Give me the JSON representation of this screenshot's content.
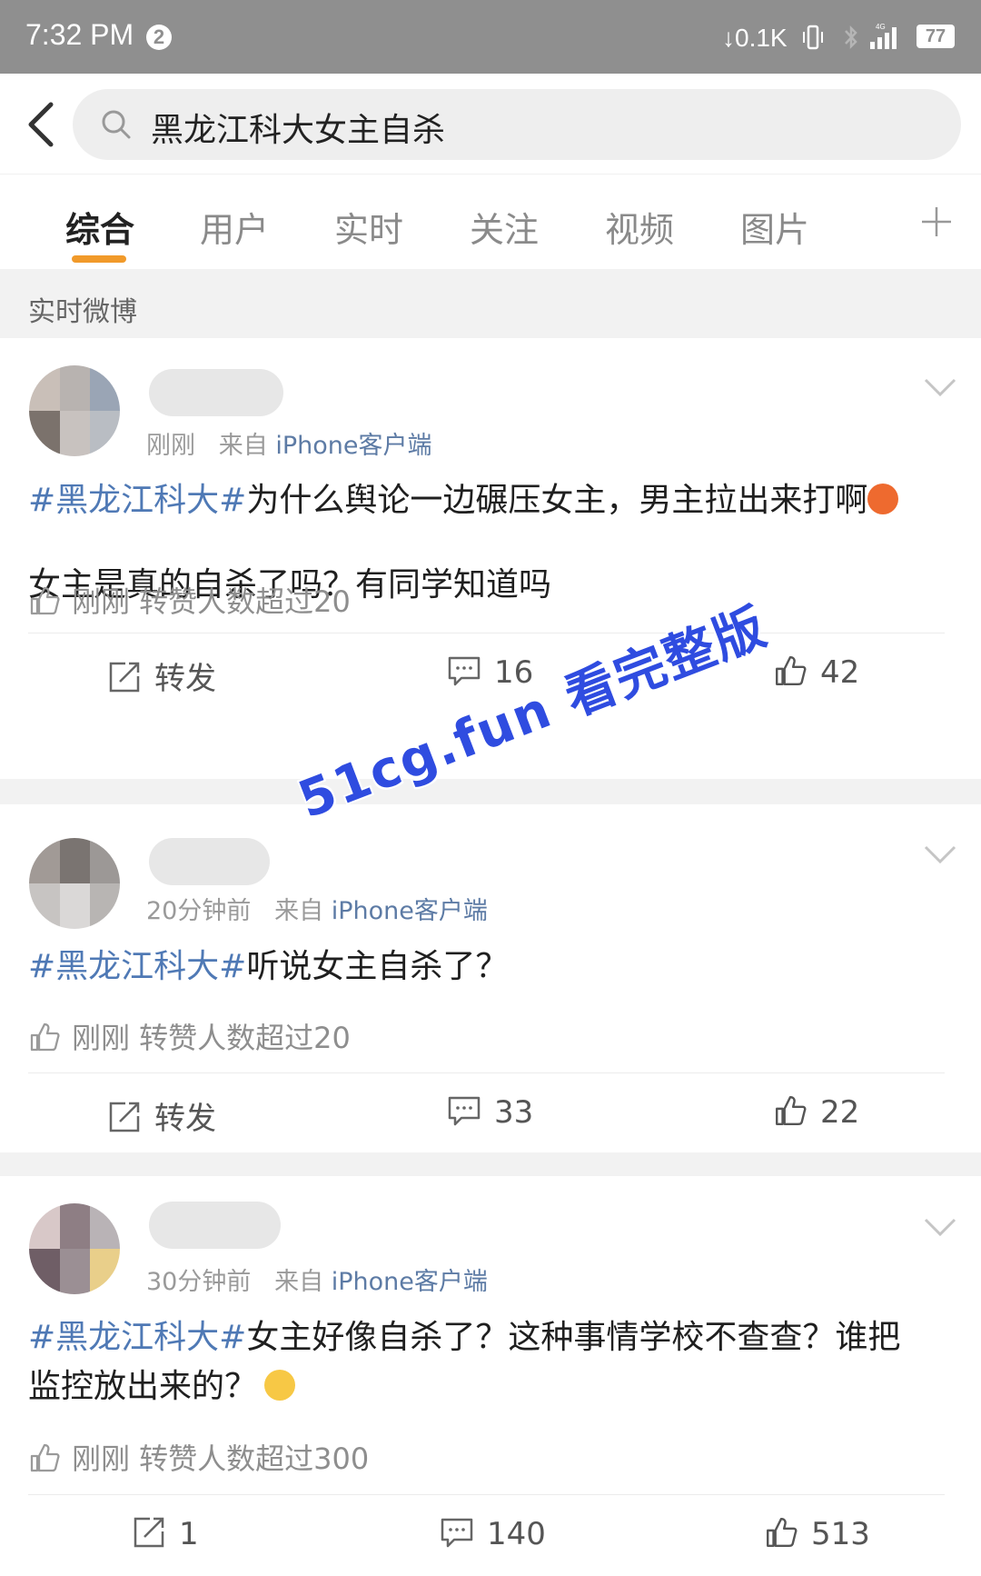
{
  "status_bar": {
    "time": "7:32 PM",
    "notification_count": "2",
    "net_speed": "0.1K",
    "battery": "77"
  },
  "search": {
    "query": "黑龙江科大女主自杀"
  },
  "tabs": [
    {
      "label": "综合",
      "active": true
    },
    {
      "label": "用户"
    },
    {
      "label": "实时"
    },
    {
      "label": "关注"
    },
    {
      "label": "视频"
    },
    {
      "label": "图片"
    }
  ],
  "section_title": "实时微博",
  "posts": [
    {
      "time": "刚刚",
      "source_prefix": "来自",
      "source": "iPhone客户端",
      "hashtag": "#黑龙江科大#",
      "text_line1": "为什么舆论一边碾压女主，男主拉出来打啊",
      "text_line2": "女主是真的自杀了吗？有同学知道吗",
      "like_status": "刚刚 转赞人数超过20",
      "repost_label": "转发",
      "comments": "16",
      "likes": "42"
    },
    {
      "time": "20分钟前",
      "source_prefix": "来自",
      "source": "iPhone客户端",
      "hashtag": "#黑龙江科大#",
      "text_line1": "听说女主自杀了？",
      "like_status": "刚刚 转赞人数超过20",
      "repost_label": "转发",
      "comments": "33",
      "likes": "22"
    },
    {
      "time": "30分钟前",
      "source_prefix": "来自",
      "source": "iPhone客户端",
      "hashtag": "#黑龙江科大#",
      "text_line1": "女主好像自杀了？这种事情学校不查查？谁把",
      "text_line2": "监控放出来的？",
      "like_status": "刚刚 转赞人数超过300",
      "reposts": "1",
      "comments": "140",
      "likes": "513"
    }
  ],
  "watermark": "51cg.fun 看完整版",
  "colors": {
    "accent": "#f19a2a",
    "hashtag": "#4f79b5",
    "source_link": "#5d7ba5",
    "watermark": "#2f4ce0"
  }
}
